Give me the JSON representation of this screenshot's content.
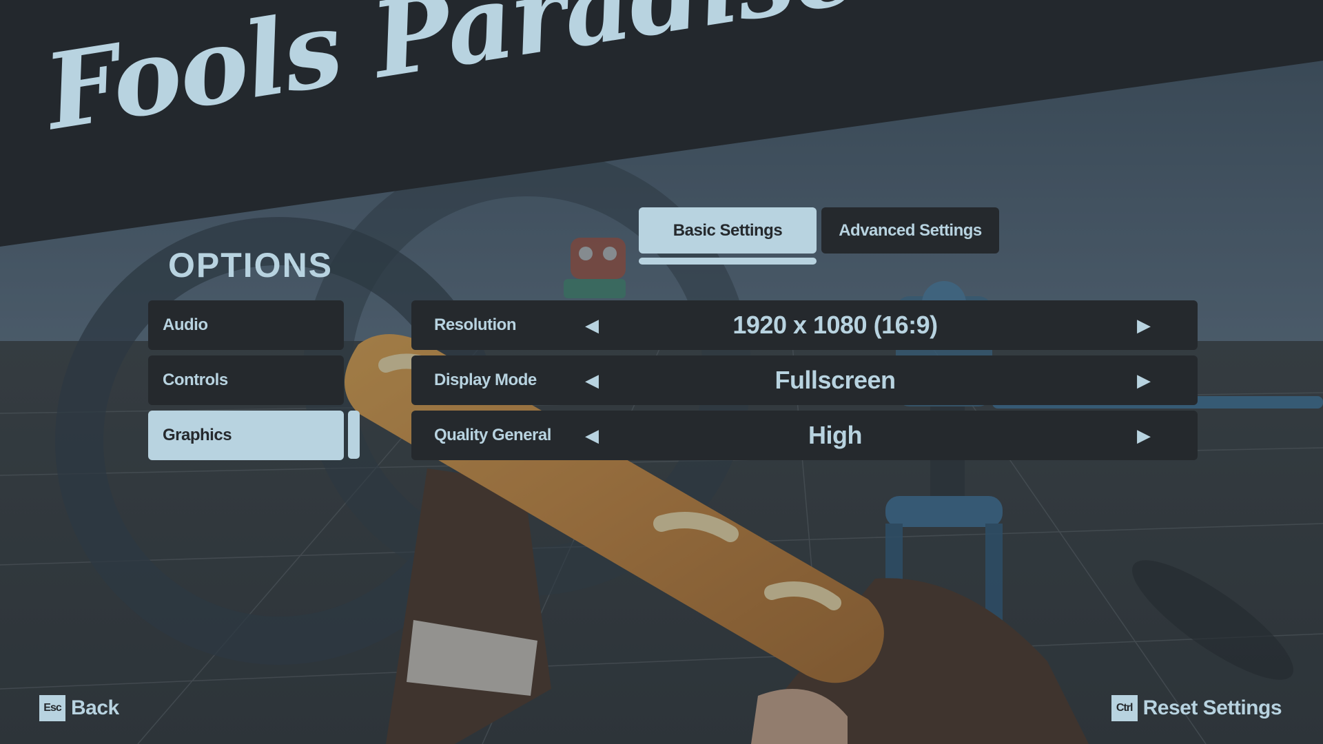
{
  "title": "Fools Paradise",
  "menu": {
    "heading": "OPTIONS",
    "items": [
      {
        "label": "Audio"
      },
      {
        "label": "Controls"
      },
      {
        "label": "Graphics",
        "active": true
      }
    ]
  },
  "tabs": [
    {
      "label": "Basic Settings",
      "active": true
    },
    {
      "label": "Advanced Settings",
      "active": false
    }
  ],
  "settings": [
    {
      "label": "Resolution",
      "value": "1920 x 1080 (16:9)"
    },
    {
      "label": "Display Mode",
      "value": "Fullscreen"
    },
    {
      "label": "Quality General",
      "value": "High"
    }
  ],
  "hints": {
    "back": {
      "key": "Esc",
      "label": "Back"
    },
    "reset": {
      "key": "Ctrl",
      "label": "Reset Settings"
    }
  },
  "icons": {
    "arrow_left": "left-arrow-icon",
    "arrow_right": "right-arrow-icon"
  },
  "colors": {
    "accent": "#b8d3e0",
    "panel": "#25292d",
    "banner": "#23282d"
  }
}
